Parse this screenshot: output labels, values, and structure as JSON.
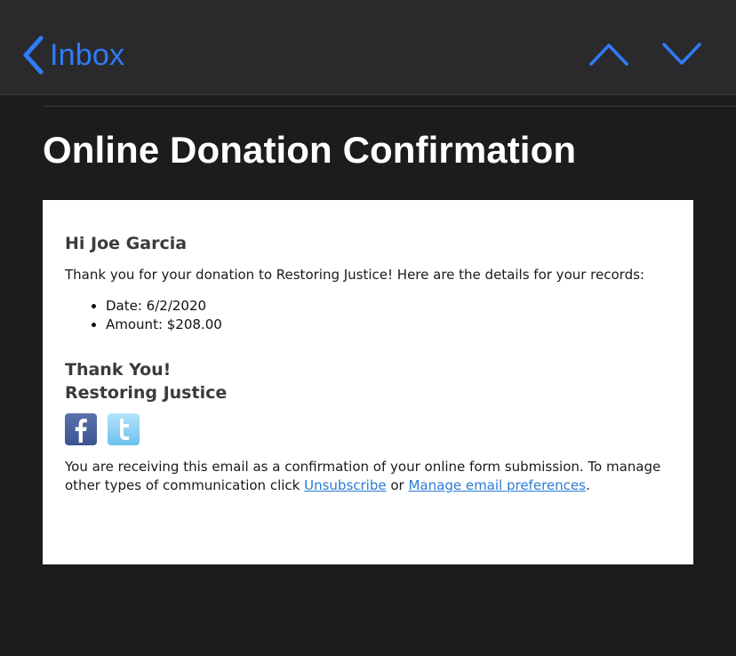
{
  "nav": {
    "back_label": "Inbox",
    "accent": "#2f7cf6"
  },
  "email": {
    "subject": "Online Donation Confirmation",
    "greeting": "Hi Joe Garcia",
    "intro": "Thank you for your donation to Restoring Justice! Here are the details for your records:",
    "details": [
      "Date: 6/2/2020",
      "Amount: $208.00"
    ],
    "signoff_line1": "Thank You!",
    "signoff_line2": "Restoring Justice",
    "social": [
      "facebook-icon",
      "twitter-icon"
    ],
    "footer_text": "You are receiving this email as a confirmation of your online form submission. To manage other types of communication click ",
    "unsubscribe_label": "Unsubscribe",
    "footer_or": " or ",
    "manage_label": "Manage email preferences",
    "footer_end": "."
  }
}
